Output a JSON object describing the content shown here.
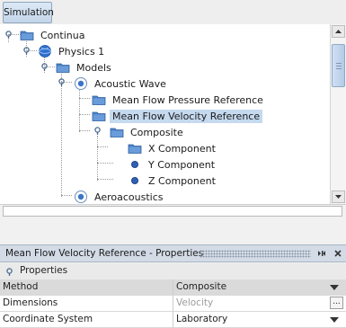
{
  "tabs": [
    {
      "label": "Simulation"
    }
  ],
  "tree": {
    "nodes": [
      {
        "label": "Continua"
      },
      {
        "label": "Physics 1"
      },
      {
        "label": "Models"
      },
      {
        "label": "Acoustic Wave"
      },
      {
        "label": "Mean Flow Pressure Reference"
      },
      {
        "label": "Mean Flow Velocity Reference"
      },
      {
        "label": "Composite"
      },
      {
        "label": "X Component"
      },
      {
        "label": "Y Component"
      },
      {
        "label": "Z Component"
      },
      {
        "label": "Aeroacoustics"
      }
    ],
    "selected": "Mean Flow Velocity Reference"
  },
  "properties": {
    "title": "Mean Flow Velocity Reference - Properties",
    "section_label": "Properties",
    "header": {
      "col1": "Method",
      "col2": "Composite"
    },
    "rows": [
      {
        "name": "Dimensions",
        "value": "Velocity"
      },
      {
        "name": "Coordinate System",
        "value": "Laboratory"
      }
    ]
  },
  "colors": {
    "selection": "#c5d9ef",
    "folder": "#4c82c7",
    "header_bg": "#d3dbe6"
  },
  "icons": [
    "pin-icon",
    "folder-icon",
    "physics-globe-icon",
    "model-icon",
    "dot-icon",
    "scroll-up-icon",
    "scroll-down-icon",
    "dropdown-icon",
    "ellipsis-icon",
    "float-icon",
    "minimize-icon",
    "close-icon"
  ]
}
